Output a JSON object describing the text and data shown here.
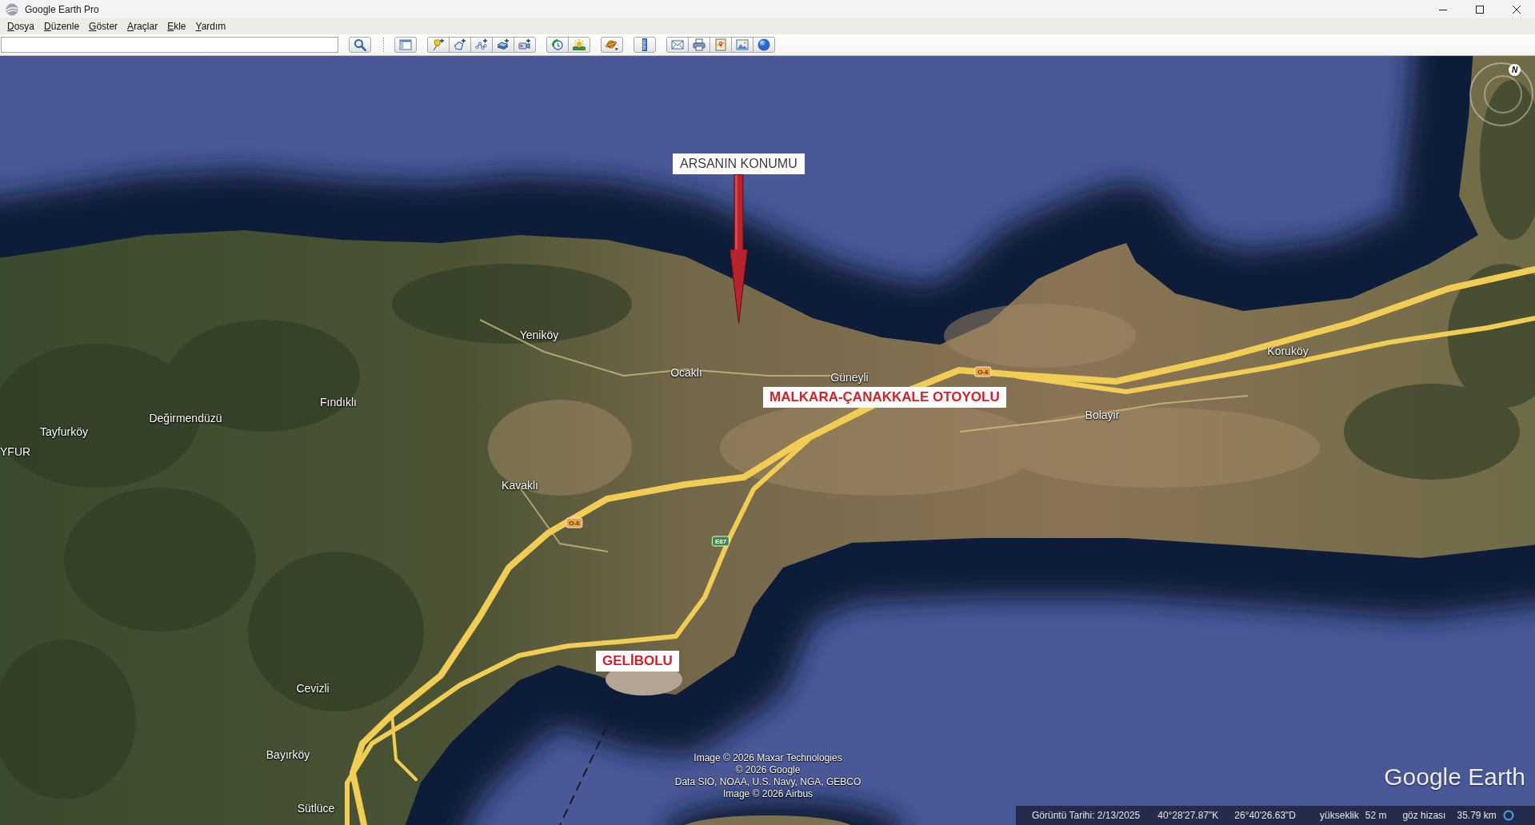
{
  "window": {
    "title": "Google Earth Pro"
  },
  "menu": [
    "Dosya",
    "Düzenle",
    "Göster",
    "Araçlar",
    "Ekle",
    "Yardım"
  ],
  "toolbar": {
    "groups": [
      [
        {
          "kind": "search"
        }
      ],
      [
        {
          "kind": "sidebar"
        }
      ],
      [
        {
          "kind": "placemark"
        },
        {
          "kind": "polygon"
        },
        {
          "kind": "path"
        },
        {
          "kind": "overlay"
        },
        {
          "kind": "tour"
        }
      ],
      [
        {
          "kind": "history"
        },
        {
          "kind": "sun"
        }
      ],
      [
        {
          "kind": "planet"
        }
      ],
      [
        {
          "kind": "ruler"
        }
      ],
      [
        {
          "kind": "email"
        },
        {
          "kind": "print"
        },
        {
          "kind": "maps"
        },
        {
          "kind": "image"
        },
        {
          "kind": "web"
        }
      ]
    ]
  },
  "map": {
    "callouts": [
      {
        "kind": "pointer",
        "label": "ARSANIN KONUMU"
      },
      {
        "kind": "label",
        "label": "MALKARA-ÇANAKKALE OTOYOLU"
      },
      {
        "kind": "label",
        "label": "GELİBOLU"
      }
    ],
    "place_labels": [
      "Yeniköy",
      "Ocaklı",
      "Koruköy",
      "Güneyli",
      "Fındıklı",
      "Bolayir",
      "Değirmendüzü",
      "Tayfurköy",
      "YFUR",
      "Kavaklı",
      "Cevizli",
      "Bayırköy",
      "Sütlüce"
    ],
    "road_shields": [
      {
        "label": "O-6",
        "color": "#e9a445"
      },
      {
        "label": "O-6",
        "color": "#e9a445"
      },
      {
        "label": "E87",
        "color": "#3d8c45"
      }
    ],
    "compass": {
      "north": "N"
    },
    "attribution": [
      "Image © 2026 Maxar Technologies",
      "© 2026 Google",
      "Data SIO, NOAA, U.S. Navy, NGA, GEBCO",
      "Image © 2026 Airbus"
    ],
    "logo": "Google Earth"
  },
  "status_bar": {
    "imagery_date": "Görüntü Tarihi: 2/13/2025",
    "latitude": "40°28'27.87\"K",
    "longitude": "26°40'26.63\"D",
    "elevation_label": "yükseklik",
    "elevation": "52 m",
    "eye_altitude_label": "göz hizası",
    "eye_altitude": "35.79 km"
  }
}
